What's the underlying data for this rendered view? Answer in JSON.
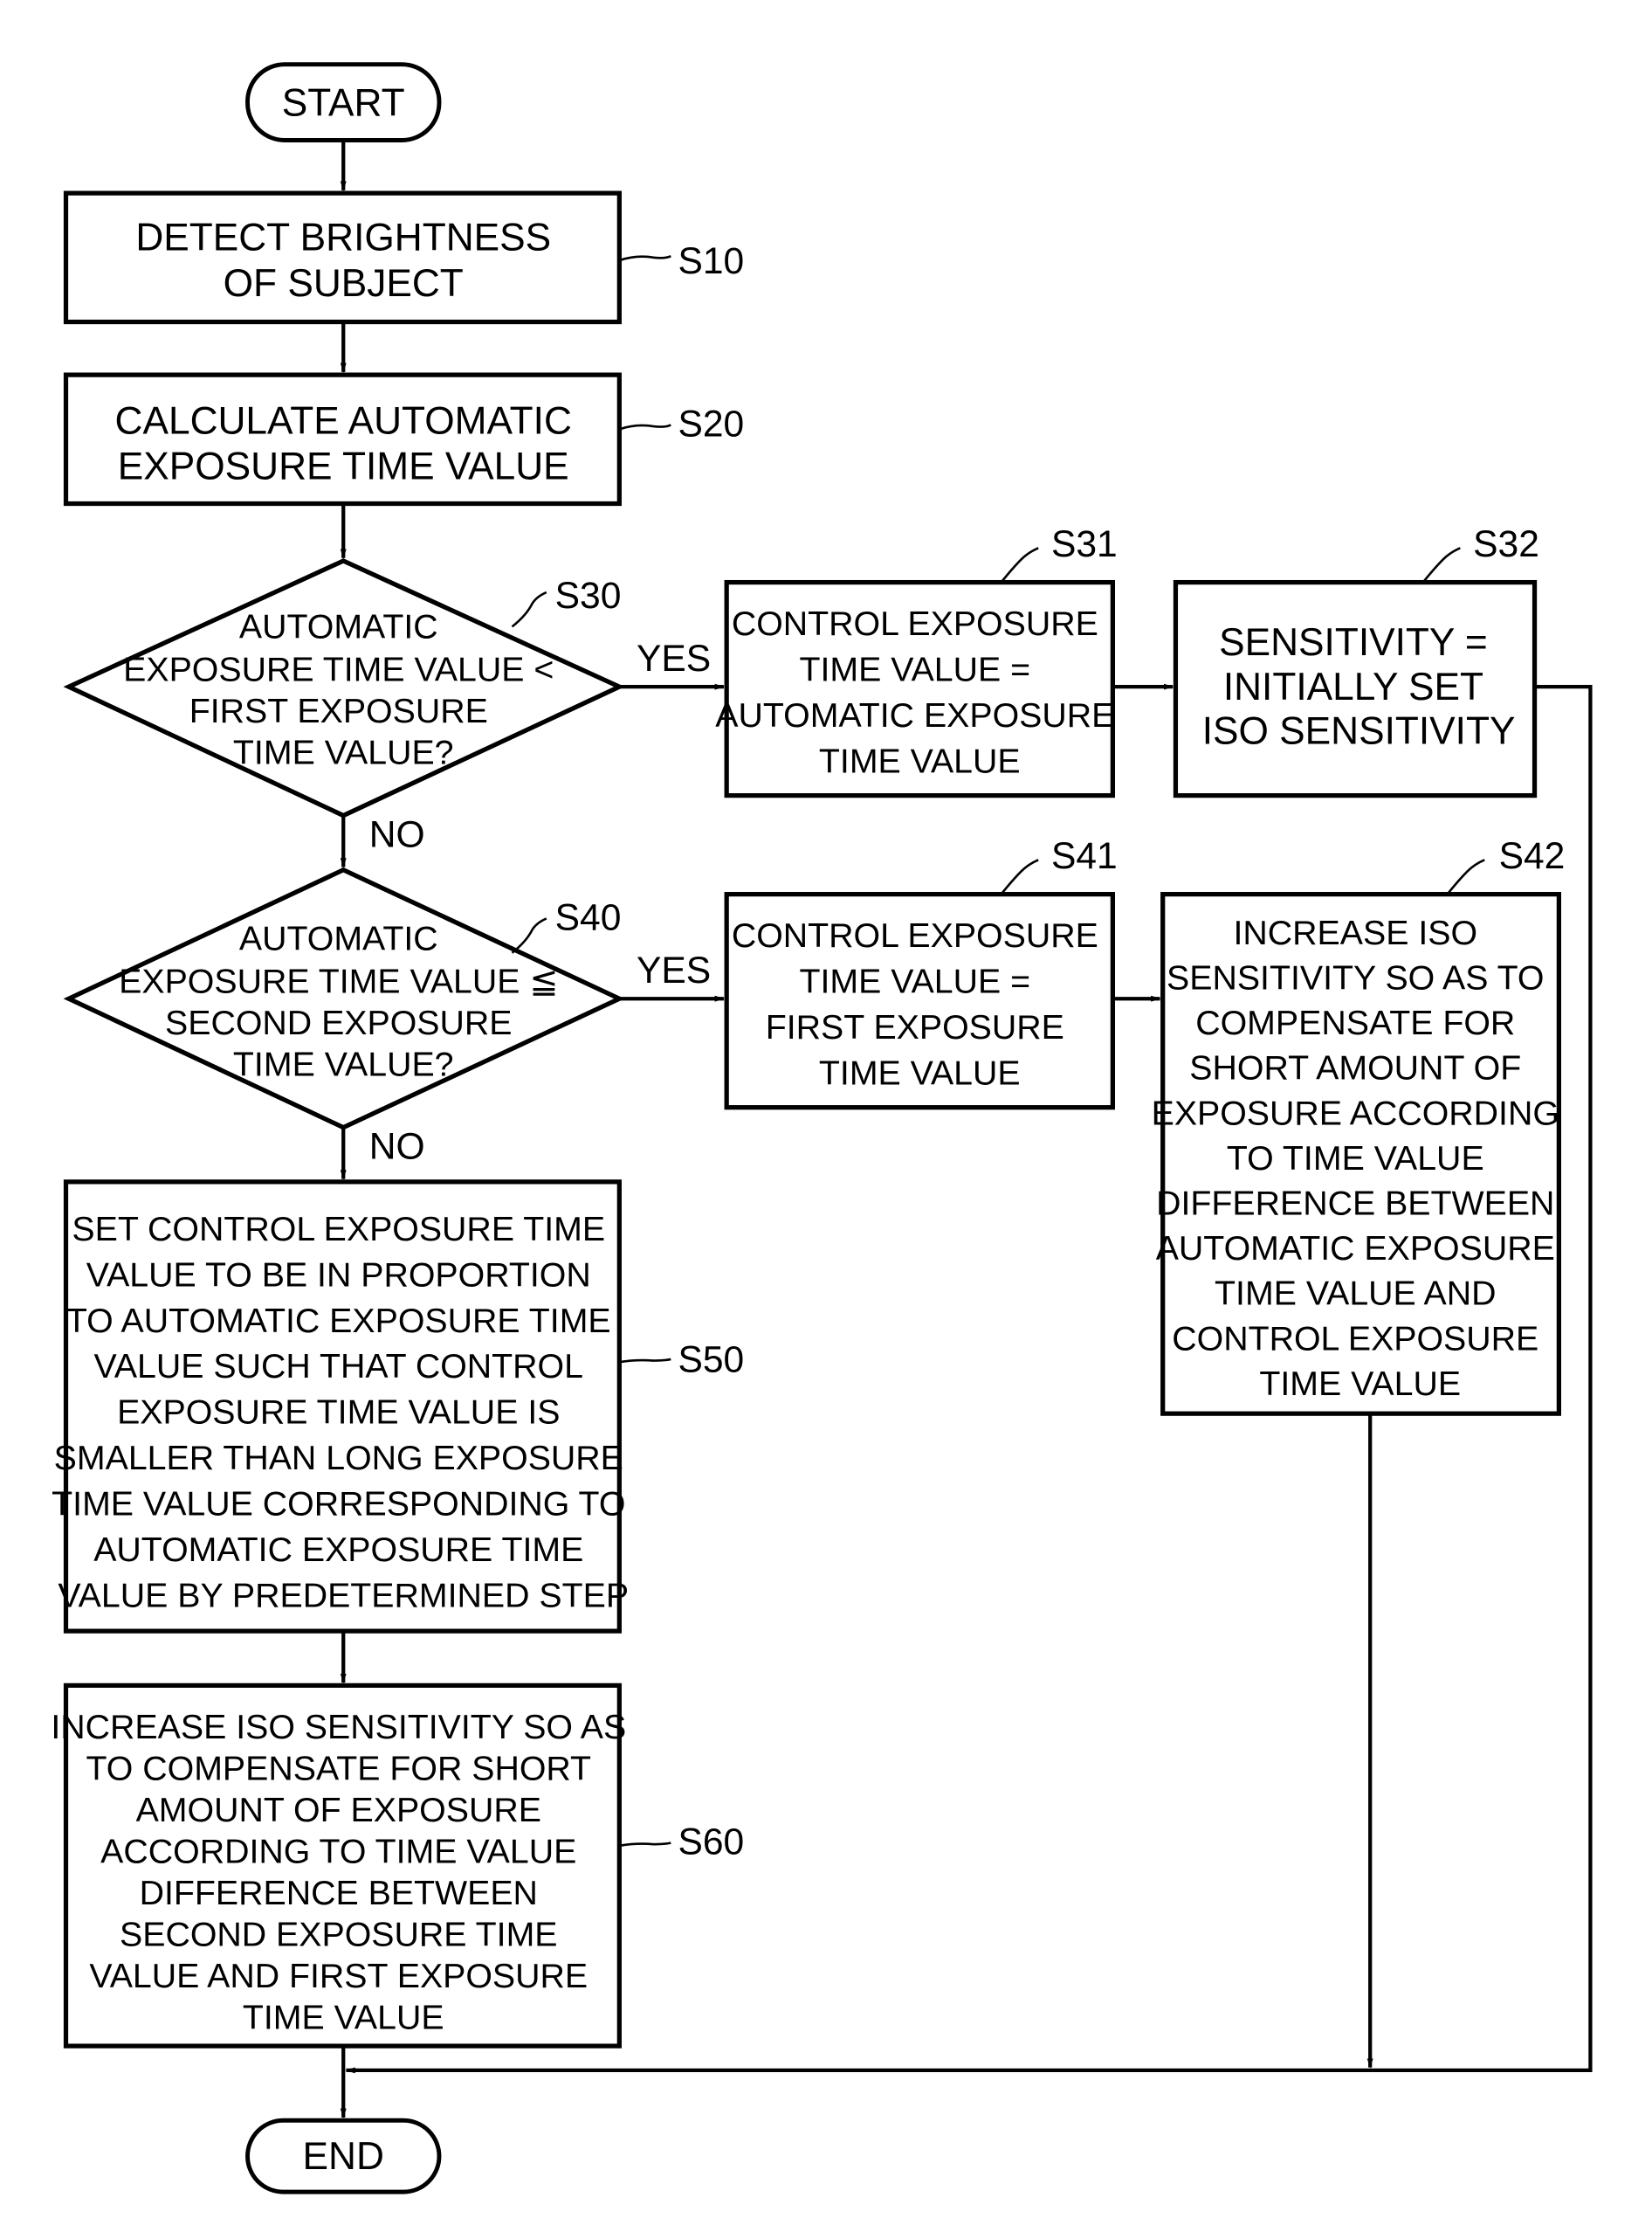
{
  "figure": {
    "start": "START",
    "end": "END",
    "steps": {
      "s10": {
        "id": "S10",
        "lines": [
          "DETECT BRIGHTNESS",
          "OF SUBJECT"
        ]
      },
      "s20": {
        "id": "S20",
        "lines": [
          "CALCULATE AUTOMATIC",
          "EXPOSURE TIME VALUE"
        ]
      },
      "s30": {
        "id": "S30",
        "lines": [
          "AUTOMATIC",
          "EXPOSURE TIME VALUE <",
          "FIRST EXPOSURE",
          "TIME VALUE?"
        ]
      },
      "s31": {
        "id": "S31",
        "lines": [
          "CONTROL EXPOSURE",
          "TIME VALUE =",
          "AUTOMATIC EXPOSURE",
          "TIME VALUE"
        ]
      },
      "s32": {
        "id": "S32",
        "lines": [
          "SENSITIVITY =",
          "INITIALLY SET",
          "ISO SENSITIVITY"
        ]
      },
      "s40": {
        "id": "S40",
        "lines": [
          "AUTOMATIC",
          "EXPOSURE TIME VALUE ≦",
          "SECOND EXPOSURE",
          "TIME VALUE?"
        ]
      },
      "s41": {
        "id": "S41",
        "lines": [
          "CONTROL EXPOSURE",
          "TIME VALUE =",
          "FIRST EXPOSURE",
          "TIME VALUE"
        ]
      },
      "s42": {
        "id": "S42",
        "lines": [
          "INCREASE ISO",
          "SENSITIVITY SO AS TO",
          "COMPENSATE FOR",
          "SHORT AMOUNT OF",
          "EXPOSURE ACCORDING",
          "TO TIME VALUE",
          "DIFFERENCE BETWEEN",
          "AUTOMATIC EXPOSURE",
          "TIME VALUE AND",
          "CONTROL EXPOSURE",
          "TIME VALUE"
        ]
      },
      "s50": {
        "id": "S50",
        "lines": [
          "SET CONTROL EXPOSURE TIME",
          "VALUE TO BE IN PROPORTION",
          "TO AUTOMATIC EXPOSURE TIME",
          "VALUE SUCH THAT CONTROL",
          "EXPOSURE TIME VALUE IS",
          "SMALLER THAN LONG EXPOSURE",
          "TIME VALUE CORRESPONDING TO",
          "AUTOMATIC EXPOSURE TIME",
          "VALUE BY PREDETERMINED STEP"
        ]
      },
      "s60": {
        "id": "S60",
        "lines": [
          "INCREASE ISO SENSITIVITY SO AS",
          "TO COMPENSATE FOR SHORT",
          "AMOUNT OF EXPOSURE",
          "ACCORDING TO TIME VALUE",
          "DIFFERENCE BETWEEN",
          "SECOND EXPOSURE TIME",
          "VALUE AND FIRST EXPOSURE",
          "TIME VALUE"
        ]
      }
    },
    "branches": {
      "s30_yes": "YES",
      "s30_no": "NO",
      "s40_yes": "YES",
      "s40_no": "NO"
    }
  }
}
